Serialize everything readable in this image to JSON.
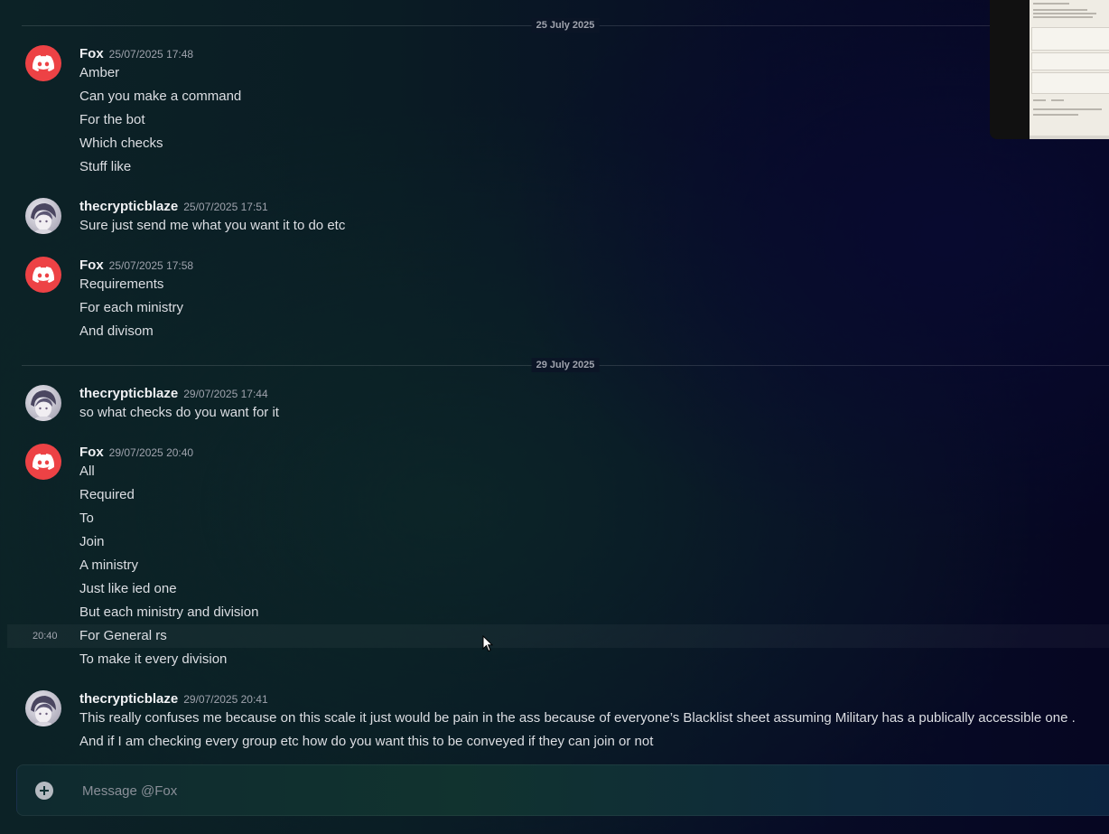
{
  "dividers": [
    {
      "label": "25 July 2025"
    },
    {
      "label": "29 July 2025"
    }
  ],
  "groups": [
    {
      "author": "Fox",
      "avatar": "discord-logo-icon",
      "timestamp": "25/07/2025 17:48",
      "lines": [
        "Amber",
        "Can you make a command",
        "For the bot",
        "Which checks",
        "Stuff like"
      ]
    },
    {
      "author": "thecrypticblaze",
      "avatar": "user-avatar-anime",
      "timestamp": "25/07/2025 17:51",
      "lines": [
        "Sure just send me what you want it to do etc"
      ]
    },
    {
      "author": "Fox",
      "avatar": "discord-logo-icon",
      "timestamp": "25/07/2025 17:58",
      "lines": [
        "Requirements",
        "For each ministry",
        "And divisom"
      ]
    },
    {
      "author": "thecrypticblaze",
      "avatar": "user-avatar-anime",
      "timestamp": "29/07/2025 17:44",
      "lines": [
        "so what checks do you want for it"
      ]
    },
    {
      "author": "Fox",
      "avatar": "discord-logo-icon",
      "timestamp": "29/07/2025 20:40",
      "lines": [
        "All",
        "Required",
        "To",
        "Join",
        "A ministry",
        "Just like ied one",
        "But each ministry and division",
        "For General rs",
        "To make it every division"
      ]
    },
    {
      "author": "thecrypticblaze",
      "avatar": "user-avatar-anime",
      "timestamp": "29/07/2025 20:41",
      "lines": [
        "This really confuses me because on this scale it just would be pain in the ass because of everyone’s Blacklist sheet assuming Military has a publically accessible one .",
        "And if I am checking every group  etc how do you want this to be conveyed if they can join or not"
      ]
    }
  ],
  "hover": {
    "time": "20:40"
  },
  "composer": {
    "placeholder": "Message @Fox",
    "value": "",
    "icon": "add-attachment-icon"
  },
  "colors": {
    "discord_red": "#ed4245",
    "text": "#dcdee3",
    "muted": "#9fa3ad"
  }
}
